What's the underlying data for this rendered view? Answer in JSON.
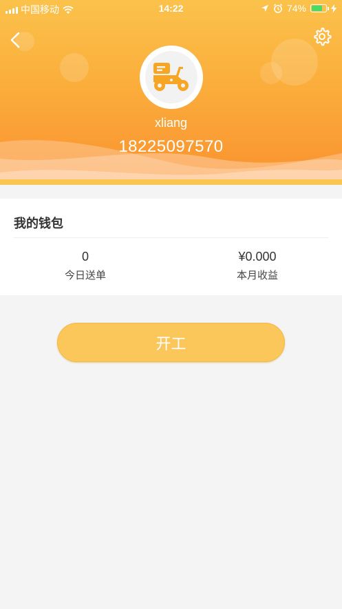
{
  "status_bar": {
    "carrier": "中国移动",
    "time": "14:22",
    "battery_pct": "74%"
  },
  "header": {
    "username": "xliang",
    "phone": "18225097570"
  },
  "wallet": {
    "title": "我的钱包",
    "stats": [
      {
        "value": "0",
        "label": "今日送单"
      },
      {
        "value": "¥0.000",
        "label": "本月收益"
      }
    ]
  },
  "actions": {
    "start_label": "开工"
  },
  "colors": {
    "header_top": "#fbc24b",
    "header_bottom": "#f9912f",
    "button": "#fbc75a",
    "battery": "#4cd964"
  },
  "icons": [
    "signal-icon",
    "wifi-icon",
    "location-icon",
    "alarm-icon",
    "battery-icon",
    "charging-icon",
    "back-icon",
    "gear-icon",
    "scooter-icon"
  ]
}
